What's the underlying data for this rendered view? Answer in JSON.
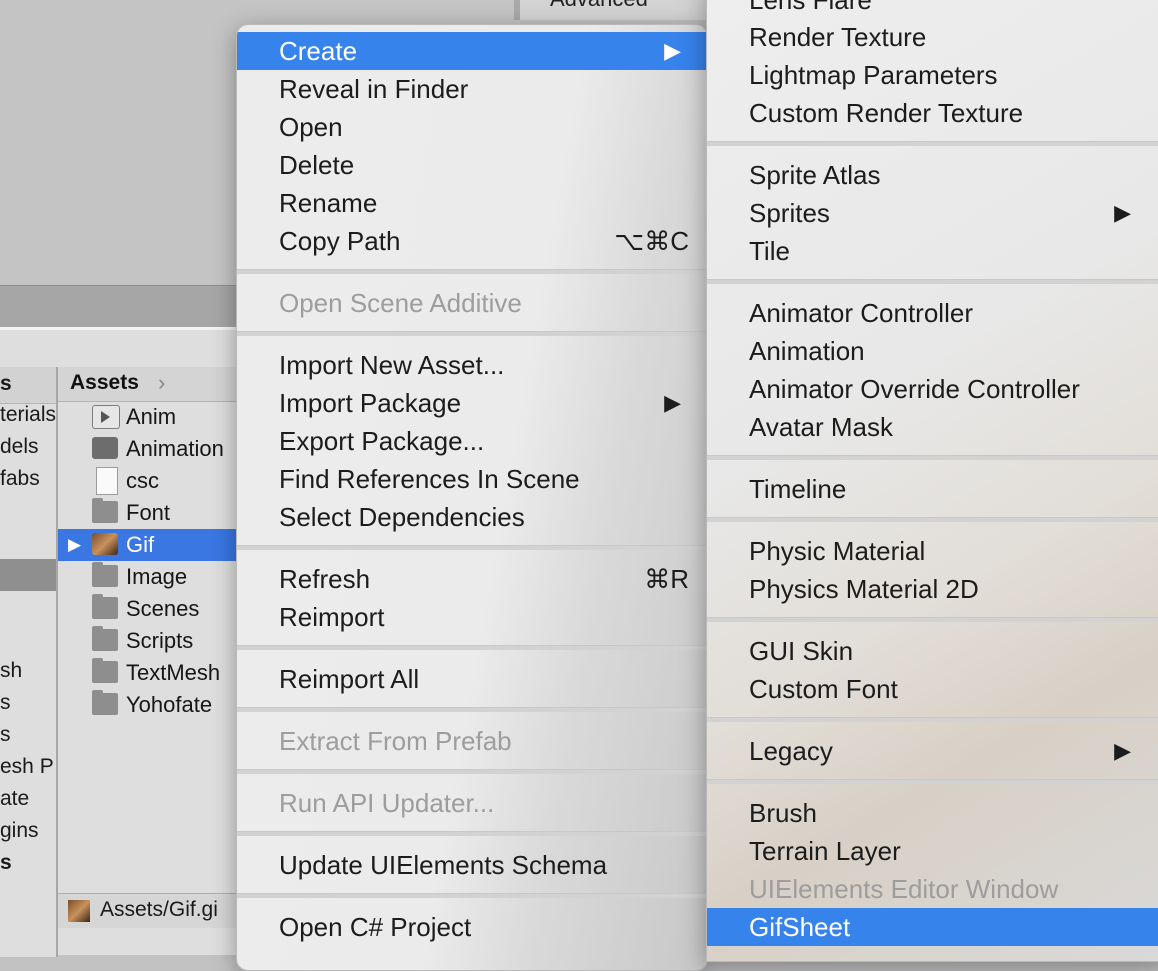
{
  "background": {
    "top_right_label": "Advanced",
    "tree_header": "s",
    "tree_items": [
      "terials",
      "dels",
      "fabs",
      "",
      "",
      "sh",
      "s",
      "s",
      "esh P",
      "ate",
      "gins",
      "s"
    ],
    "assets_header": "Assets",
    "assets": [
      {
        "name": "Anim",
        "icon": "animation-clip-icon"
      },
      {
        "name": "Animation",
        "icon": "animator-icon"
      },
      {
        "name": "csc",
        "icon": "document-icon"
      },
      {
        "name": "Font",
        "icon": "folder-icon"
      },
      {
        "name": "Gif",
        "icon": "gif-image-icon",
        "selected": true
      },
      {
        "name": "Image",
        "icon": "folder-icon"
      },
      {
        "name": "Scenes",
        "icon": "folder-icon"
      },
      {
        "name": "Scripts",
        "icon": "folder-icon"
      },
      {
        "name": "TextMesh",
        "icon": "folder-icon"
      },
      {
        "name": "Yohofate",
        "icon": "folder-icon"
      }
    ],
    "path_bar": "Assets/Gif.gi"
  },
  "context_menu": {
    "items": {
      "create": "Create",
      "reveal": "Reveal in Finder",
      "open": "Open",
      "delete": "Delete",
      "rename": "Rename",
      "copy_path": "Copy Path",
      "copy_path_shortcut": "⌥⌘C",
      "open_scene_additive": "Open Scene Additive",
      "import_new_asset": "Import New Asset...",
      "import_package": "Import Package",
      "export_package": "Export Package...",
      "find_references": "Find References In Scene",
      "select_dependencies": "Select Dependencies",
      "refresh": "Refresh",
      "refresh_shortcut": "⌘R",
      "reimport": "Reimport",
      "reimport_all": "Reimport All",
      "extract_from_prefab": "Extract From Prefab",
      "run_api_updater": "Run API Updater...",
      "update_uielements": "Update UIElements Schema",
      "open_csharp_project": "Open C# Project"
    },
    "submenu_arrow": "▶"
  },
  "create_submenu": {
    "items": {
      "lens_flare": "Lens Flare",
      "render_texture": "Render Texture",
      "lightmap_parameters": "Lightmap Parameters",
      "custom_render_texture": "Custom Render Texture",
      "sprite_atlas": "Sprite Atlas",
      "sprites": "Sprites",
      "tile": "Tile",
      "animator_controller": "Animator Controller",
      "animation": "Animation",
      "animator_override": "Animator Override Controller",
      "avatar_mask": "Avatar Mask",
      "timeline": "Timeline",
      "physic_material": "Physic Material",
      "physics_material_2d": "Physics Material 2D",
      "gui_skin": "GUI Skin",
      "custom_font": "Custom Font",
      "legacy": "Legacy",
      "brush": "Brush",
      "terrain_layer": "Terrain Layer",
      "uielements_editor_window": "UIElements Editor Window",
      "gifsheet": "GifSheet"
    },
    "submenu_arrow": "▶"
  }
}
